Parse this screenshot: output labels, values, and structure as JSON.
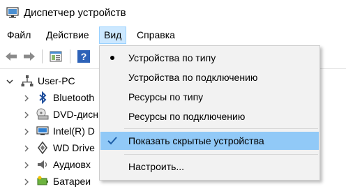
{
  "window": {
    "title": "Диспетчер устройств"
  },
  "menubar": [
    "Файл",
    "Действие",
    "Вид",
    "Справка"
  ],
  "toolbar": {
    "icons": [
      "back-arrow-icon",
      "forward-arrow-icon",
      "properties-icon",
      "help-icon"
    ]
  },
  "tree": {
    "root": "User-PC",
    "children": [
      "Bluetooth",
      "DVD-дисн",
      "Intel(R) D",
      "WD Drive",
      "Аудиовх",
      "Батареи"
    ]
  },
  "view_menu": {
    "items": [
      {
        "label": "Устройства по типу",
        "mark": "bullet"
      },
      {
        "label": "Устройства по подключению"
      },
      {
        "label": "Ресурсы по типу"
      },
      {
        "label": "Ресурсы по подключению"
      },
      {
        "label": "Показать скрытые устройства",
        "mark": "check",
        "highlighted": true
      },
      {
        "label": "Настроить..."
      }
    ]
  },
  "colors": {
    "menu_open_bg": "#cce8ff",
    "highlight_bg": "#91c9f7",
    "check_color": "#1e5fa8",
    "dropdown_bg": "#f2f2f2"
  }
}
